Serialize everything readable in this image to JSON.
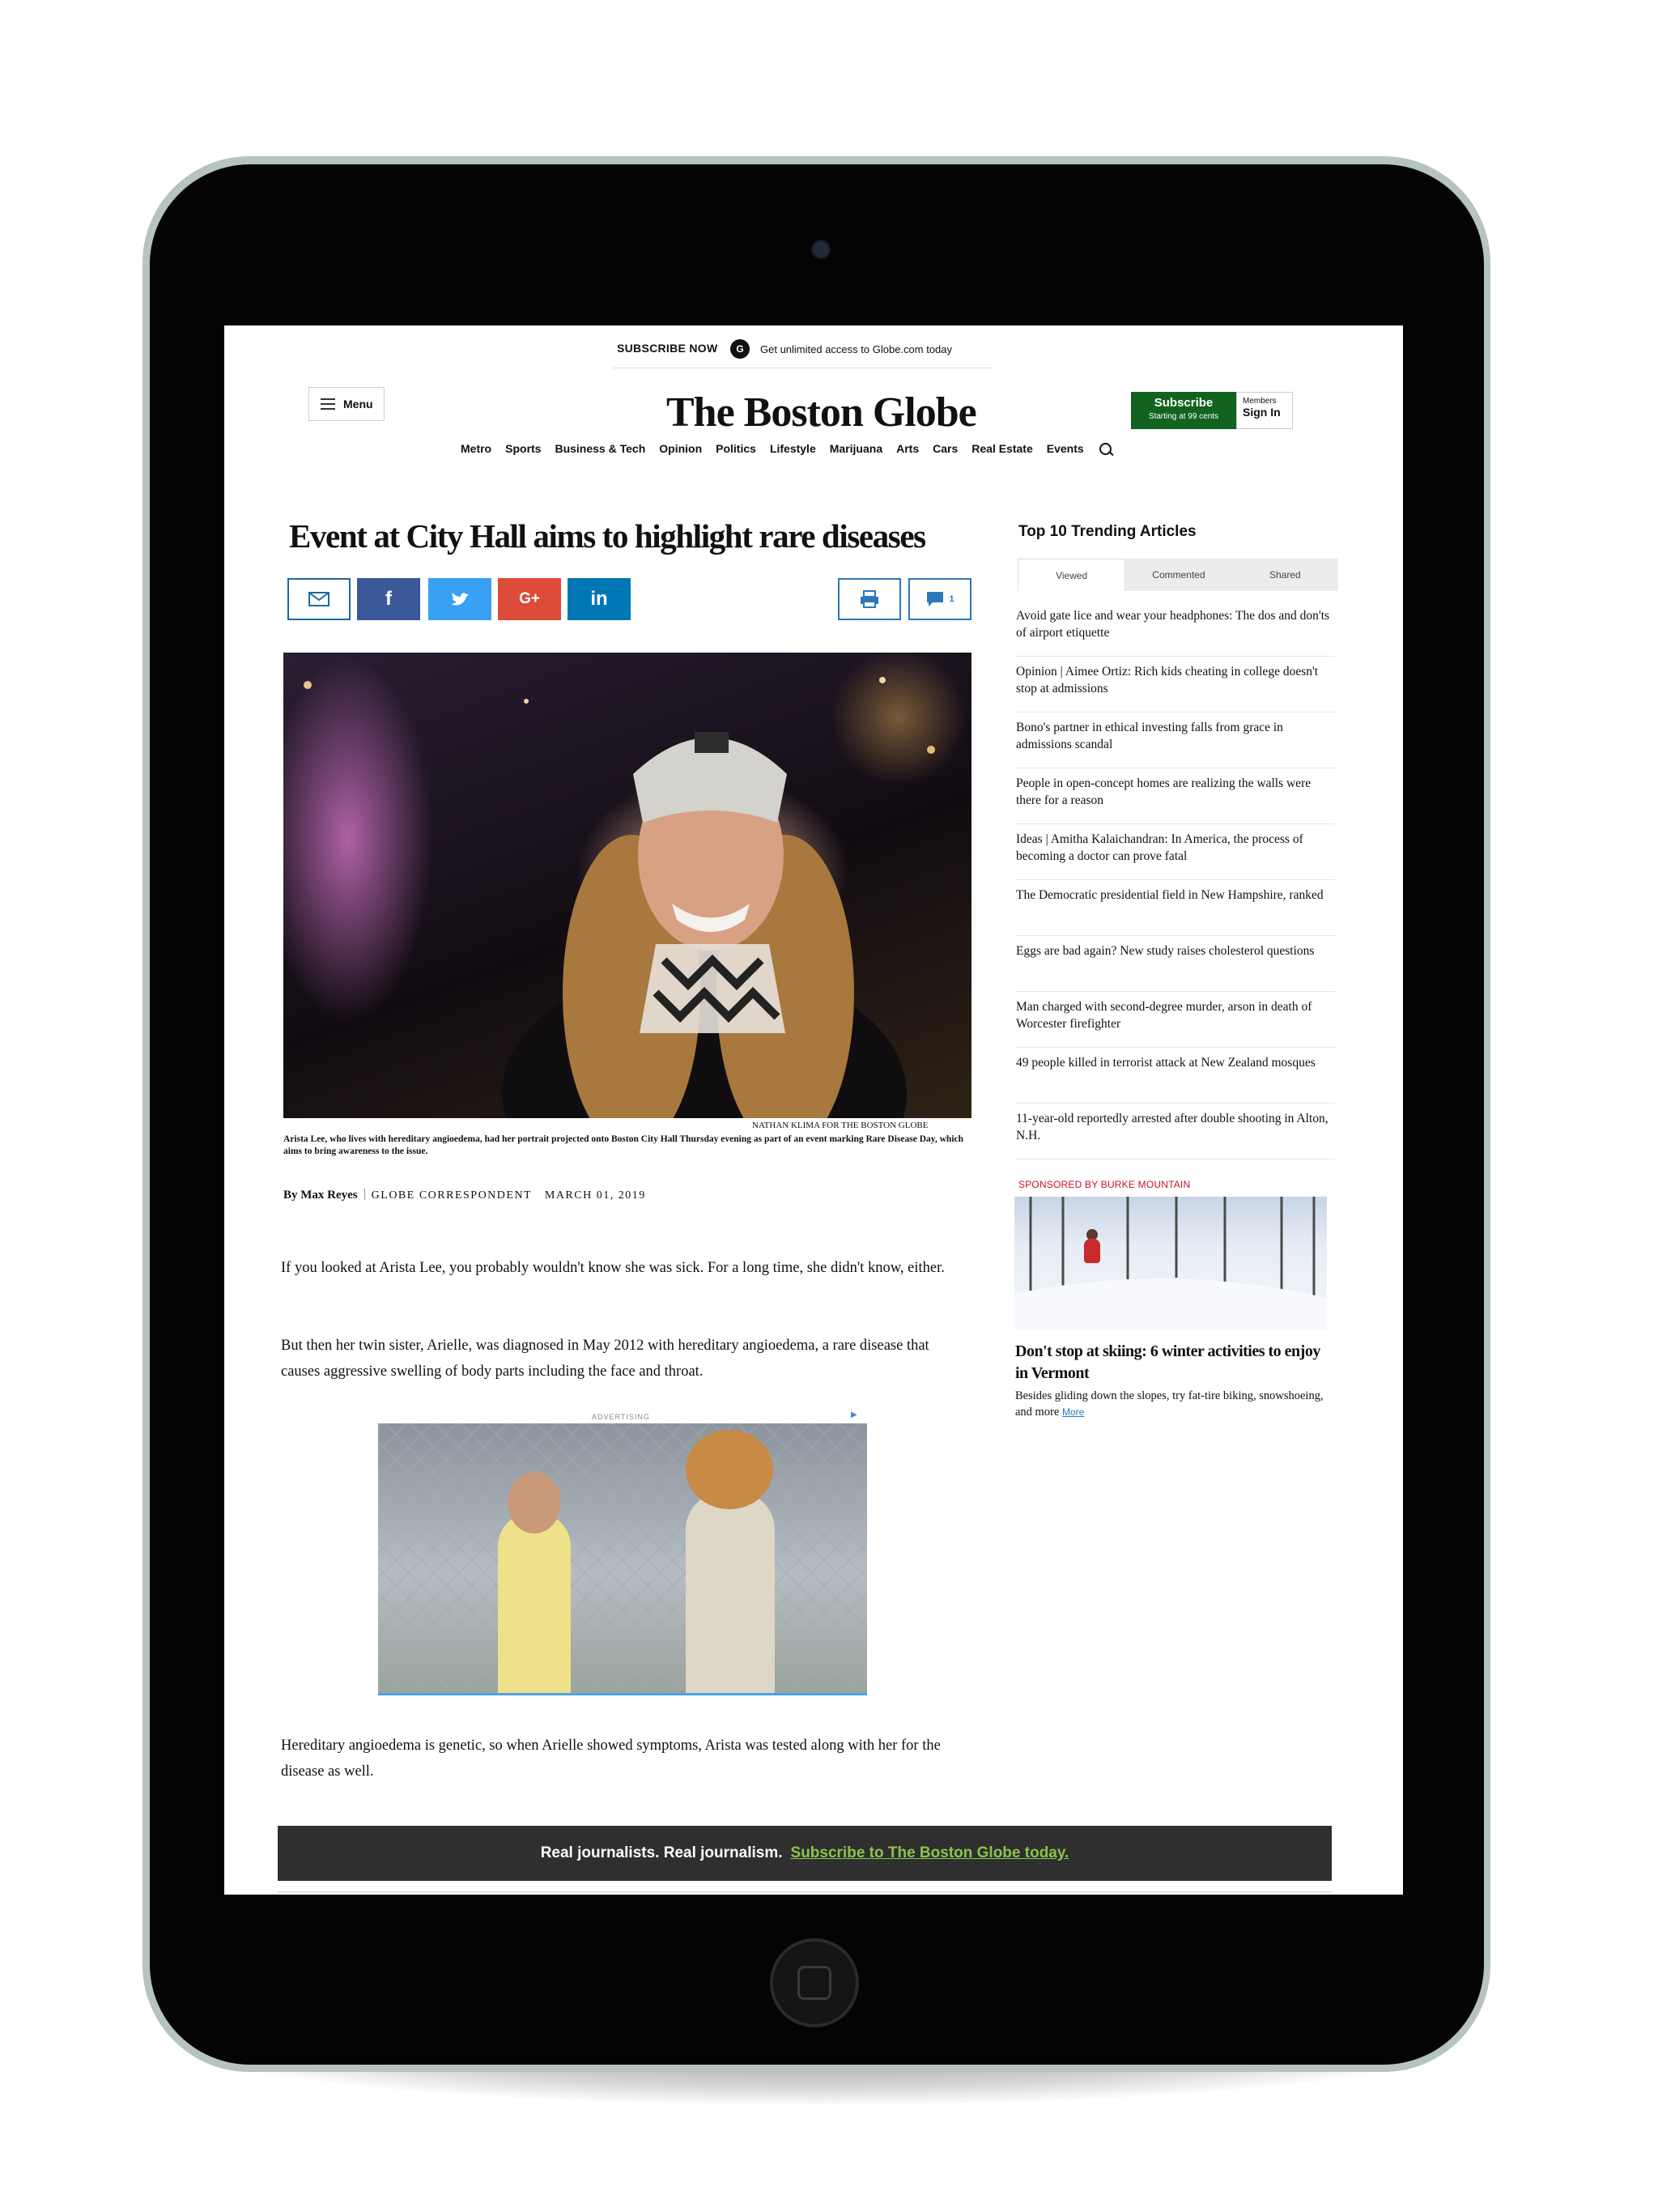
{
  "header": {
    "subscribe_now": "SUBSCRIBE NOW",
    "subscribe_now_text": "Get unlimited access to Globe.com today",
    "menu_label": "Menu",
    "masthead": "The Boston Globe",
    "subscribe_label": "Subscribe",
    "subscribe_price": "Starting at 99 cents",
    "members_label": "Members",
    "signin_label": "Sign In"
  },
  "nav": {
    "items": [
      "Metro",
      "Sports",
      "Business & Tech",
      "Opinion",
      "Politics",
      "Lifestyle",
      "Marijuana",
      "Arts",
      "Cars",
      "Real Estate",
      "Events"
    ]
  },
  "article": {
    "headline": "Event at City Hall aims to highlight rare diseases",
    "share": {
      "facebook": "f",
      "google": "G+",
      "linkedin": "in",
      "comment_count": "1"
    },
    "photo_credit": "NATHAN KLIMA FOR THE BOSTON GLOBE",
    "caption": "Arista Lee, who lives with hereditary angioedema, had her portrait projected onto Boston City Hall Thursday evening as part of an event marking Rare Disease Day, which aims to bring awareness to the issue.",
    "byline_author": "By Max Reyes",
    "byline_role": "GLOBE CORRESPONDENT",
    "byline_date": "MARCH 01, 2019",
    "paragraphs": [
      "If you looked at Arista Lee, you probably wouldn't know she was sick. For a long time, she didn't know, either.",
      "But then her twin sister, Arielle, was diagnosed in May 2012 with hereditary angioedema, a rare disease that causes aggressive swelling of body parts including the face and throat.",
      "Hereditary angioedema is genetic, so when Arielle showed symptoms, Arista was tested along with her for the disease as well."
    ],
    "ad_label": "ADVERTISING"
  },
  "sidebar": {
    "trending_title": "Top 10 Trending Articles",
    "tabs": [
      "Viewed",
      "Commented",
      "Shared"
    ],
    "articles": [
      "Avoid gate lice and wear your headphones: The dos and don'ts of airport etiquette",
      "Opinion | Aimee Ortiz: Rich kids cheating in college doesn't stop at admissions",
      "Bono's partner in ethical investing falls from grace in admissions scandal",
      "People in open-concept homes are realizing the walls were there for a reason",
      "Ideas | Amitha Kalaichandran: In America, the process of becoming a doctor can prove fatal",
      "The Democratic presidential field in New Hampshire, ranked",
      "Eggs are bad again? New study raises cholesterol questions",
      "Man charged with second-degree murder, arson in death of Worcester firefighter",
      "49 people killed in terrorist attack at New Zealand mosques",
      "11-year-old reportedly arrested after double shooting in Alton, N.H."
    ],
    "sponsored_label": "SPONSORED BY BURKE MOUNTAIN",
    "sponsored_title": "Don't stop at skiing: 6 winter activities to enjoy in Vermont",
    "sponsored_desc": "Besides gliding down the slopes, try fat-tire biking, snowshoeing, and more",
    "more_label": "More"
  },
  "banner": {
    "text": "Real journalists. Real journalism.",
    "link": "Subscribe to The Boston Globe today."
  },
  "colors": {
    "subscribe_green": "#12631f",
    "facebook": "#3b5998",
    "twitter": "#38a1f3",
    "google": "#dd4b39",
    "linkedin": "#0077b5",
    "banner_bg": "#2f2f2f",
    "banner_link": "#8bc34a",
    "sponsored_red": "#c8102e"
  }
}
